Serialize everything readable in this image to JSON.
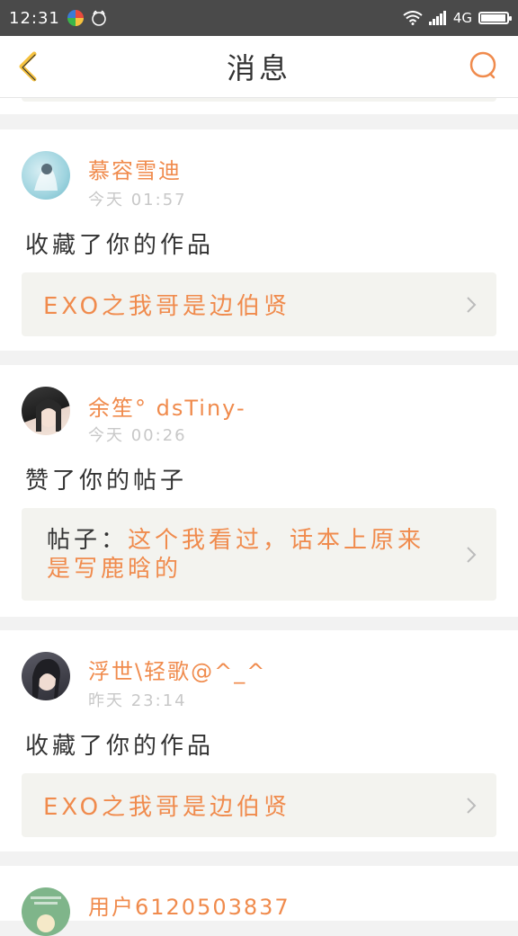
{
  "status_bar": {
    "time": "12:31",
    "network": "4G"
  },
  "header": {
    "title": "消息"
  },
  "messages": [
    {
      "user": "慕容雪迪",
      "time": "今天 01:57",
      "action": "收藏了你的作品",
      "target": "EXO之我哥是边伯贤"
    },
    {
      "user": "余笙° dsTiny-",
      "time": "今天 00:26",
      "action": "赞了你的帖子",
      "target_prefix": "帖子：",
      "target": "这个我看过，话本上原来是写鹿晗的"
    },
    {
      "user": "浮世\\轻歌@^_^",
      "time": "昨天 23:14",
      "action": "收藏了你的作品",
      "target": "EXO之我哥是边伯贤"
    },
    {
      "user": "用户6120503837"
    }
  ],
  "colors": {
    "accent": "#f08b4d",
    "status_bar": "#4a4a4a",
    "box_bg": "#f3f3ef"
  }
}
